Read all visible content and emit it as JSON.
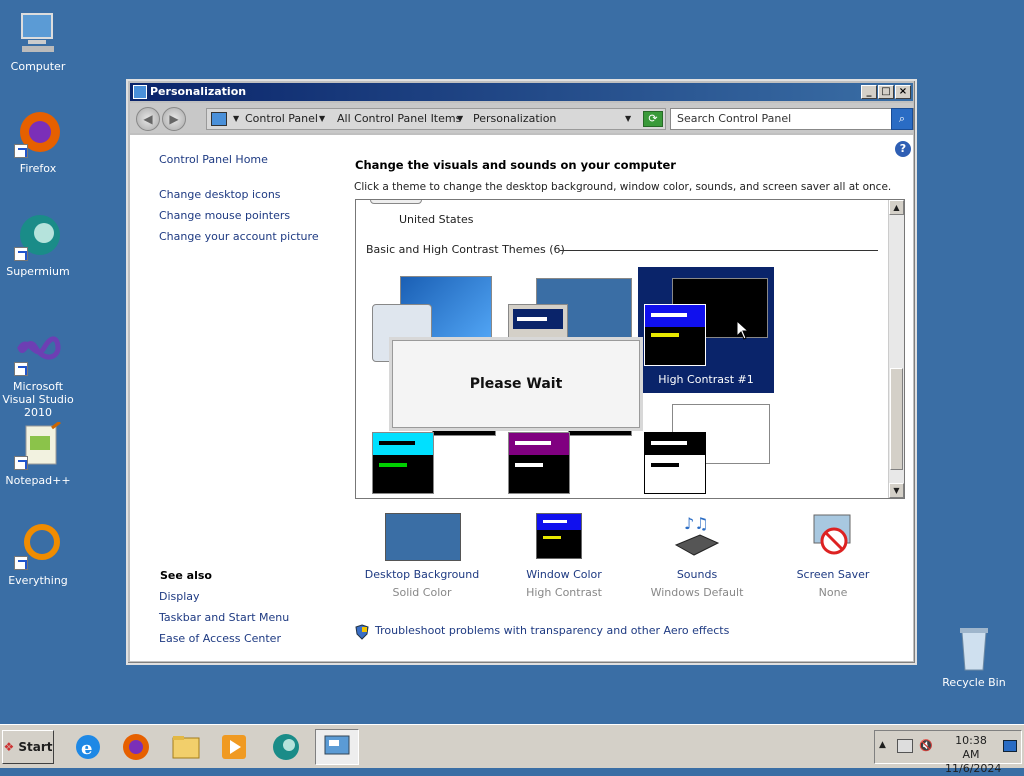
{
  "desktop_icons": [
    {
      "label": "Computer",
      "icon": "computer-icon"
    },
    {
      "label": "Firefox",
      "icon": "firefox-icon"
    },
    {
      "label": "Supermium",
      "icon": "supermium-icon"
    },
    {
      "label": "Microsoft Visual Studio 2010",
      "icon": "visual-studio-icon"
    },
    {
      "label": "Notepad++",
      "icon": "notepadpp-icon"
    },
    {
      "label": "Everything",
      "icon": "everything-icon"
    },
    {
      "label": "Recycle Bin",
      "icon": "recycle-bin-icon"
    }
  ],
  "window": {
    "title": "Personalization",
    "breadcrumbs": [
      "Control Panel",
      "All Control Panel Items",
      "Personalization"
    ],
    "search_placeholder": "Search Control Panel",
    "sidebar": {
      "home": "Control Panel Home",
      "links": [
        "Change desktop icons",
        "Change mouse pointers",
        "Change your account picture"
      ],
      "see_also_heading": "See also",
      "see_also": [
        "Display",
        "Taskbar and Start Menu",
        "Ease of Access Center"
      ]
    },
    "heading": "Change the visuals and sounds on your computer",
    "description": "Click a theme to change the desktop background, window color, sounds, and screen saver all at once.",
    "partial_theme_label": "United States",
    "group_label": "Basic and High Contrast Themes (6)",
    "selected_theme": "High Contrast #1",
    "dialog_text": "Please Wait",
    "settings": [
      {
        "label": "Desktop Background",
        "value": "Solid Color"
      },
      {
        "label": "Window Color",
        "value": "High Contrast"
      },
      {
        "label": "Sounds",
        "value": "Windows Default"
      },
      {
        "label": "Screen Saver",
        "value": "None"
      }
    ],
    "troubleshoot": "Troubleshoot problems with transparency and other Aero effects"
  },
  "taskbar": {
    "start_label": "Start",
    "time": "10:38 AM",
    "date": "11/6/2024"
  },
  "colors": {
    "desktop": "#3a6ea5",
    "title_active": "#0a246a",
    "link": "#1e3a82"
  }
}
